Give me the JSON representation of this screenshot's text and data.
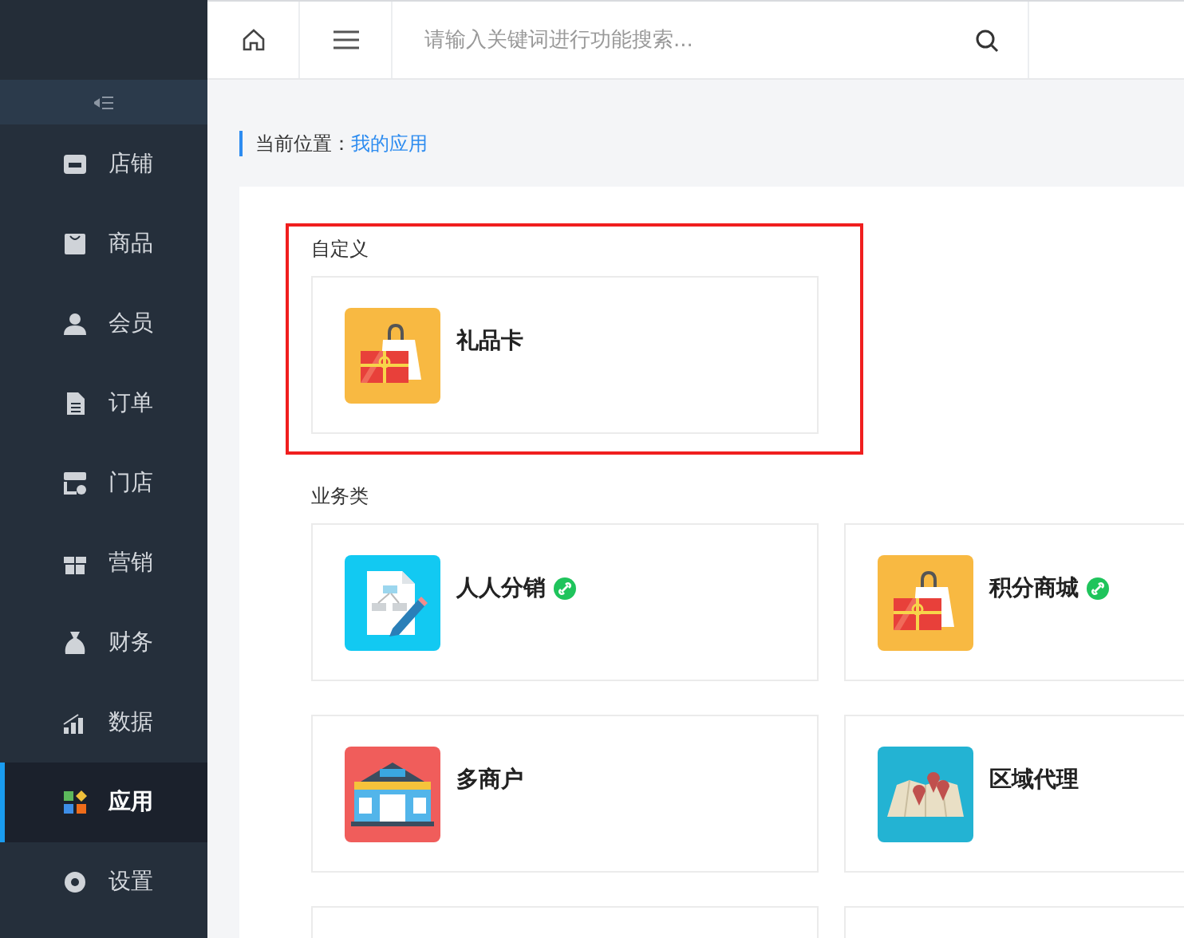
{
  "sidebar": {
    "items": [
      {
        "label": "店铺",
        "selected": false
      },
      {
        "label": "商品",
        "selected": false
      },
      {
        "label": "会员",
        "selected": false
      },
      {
        "label": "订单",
        "selected": false
      },
      {
        "label": "门店",
        "selected": false
      },
      {
        "label": "营销",
        "selected": false
      },
      {
        "label": "财务",
        "selected": false
      },
      {
        "label": "数据",
        "selected": false
      },
      {
        "label": "应用",
        "selected": true
      },
      {
        "label": "设置",
        "selected": false
      }
    ]
  },
  "search": {
    "placeholder": "请输入关键词进行功能搜索..."
  },
  "breadcrumb": {
    "label": "当前位置：",
    "current": "我的应用"
  },
  "sections": [
    {
      "title": "自定义",
      "highlighted": true,
      "apps": [
        {
          "name": "礼品卡",
          "kind": "giftcard",
          "mini_program": false
        }
      ]
    },
    {
      "title": "业务类",
      "highlighted": false,
      "apps": [
        {
          "name": "人人分销",
          "kind": "distribution",
          "mini_program": true
        },
        {
          "name": "积分商城",
          "kind": "giftcard",
          "mini_program": true
        },
        {
          "name": "多商户",
          "kind": "store",
          "mini_program": false
        },
        {
          "name": "区域代理",
          "kind": "map",
          "mini_program": false
        }
      ]
    }
  ]
}
